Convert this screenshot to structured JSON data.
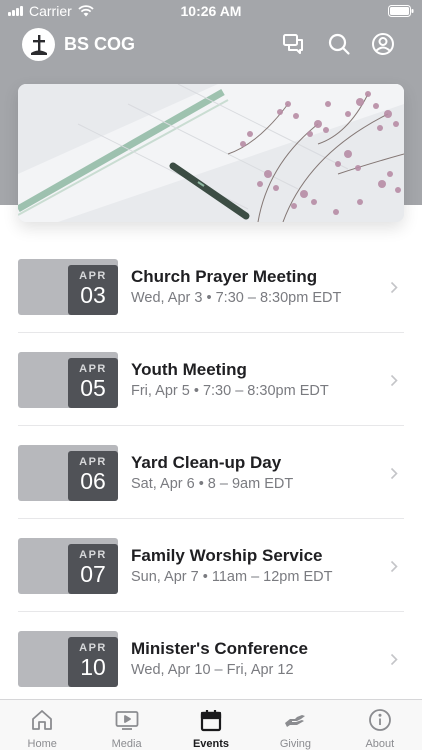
{
  "status_bar": {
    "carrier": "Carrier",
    "time": "10:26 AM"
  },
  "nav_bar": {
    "app_title": "BS COG",
    "icons": [
      "chat-icon",
      "search-icon",
      "profile-icon"
    ]
  },
  "hero": {
    "image": "open planner with pen and baby's breath flowers"
  },
  "events": [
    {
      "month": "APR",
      "day": "03",
      "title": "Church Prayer Meeting",
      "subtitle": "Wed, Apr 3 • 7:30 – 8:30pm EDT"
    },
    {
      "month": "APR",
      "day": "05",
      "title": "Youth Meeting",
      "subtitle": "Fri, Apr 5 • 7:30 – 8:30pm EDT"
    },
    {
      "month": "APR",
      "day": "06",
      "title": "Yard Clean-up Day",
      "subtitle": "Sat, Apr 6 • 8 – 9am EDT"
    },
    {
      "month": "APR",
      "day": "07",
      "title": "Family Worship Service",
      "subtitle": "Sun, Apr 7 • 11am – 12pm EDT"
    },
    {
      "month": "APR",
      "day": "10",
      "title": "Minister's Conference",
      "subtitle": "Wed, Apr 10 – Fri, Apr 12"
    }
  ],
  "tab_bar": {
    "tabs": [
      {
        "label": "Home",
        "icon": "home-icon",
        "active": false
      },
      {
        "label": "Media",
        "icon": "media-icon",
        "active": false
      },
      {
        "label": "Events",
        "icon": "calendar-icon",
        "active": true
      },
      {
        "label": "Giving",
        "icon": "giving-icon",
        "active": false
      },
      {
        "label": "About",
        "icon": "info-icon",
        "active": false
      }
    ]
  },
  "colors": {
    "header_bg": "#a4a6aa",
    "date_badge": "#505257",
    "thumb_bg": "#b7b8bc",
    "active_tab": "#1a1a1c",
    "inactive_tab": "#8b8c90"
  }
}
